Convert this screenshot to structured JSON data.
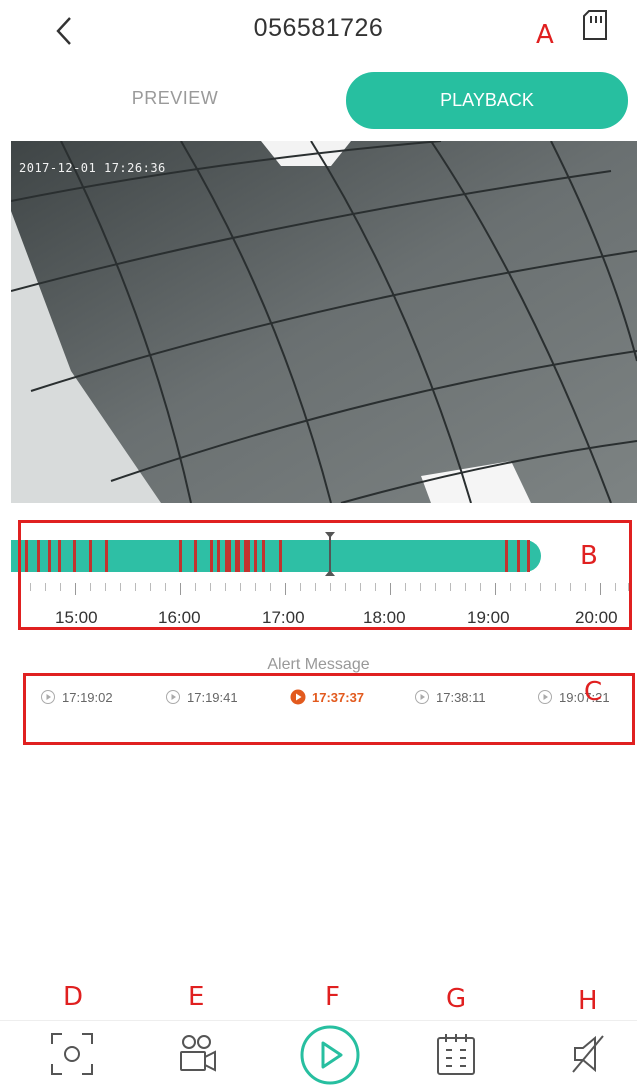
{
  "header": {
    "title": "056581726",
    "back_icon": "chevron-left-icon",
    "sd_card_icon": "sd-card-icon"
  },
  "tabs": [
    {
      "label": "PREVIEW",
      "active": false
    },
    {
      "label": "PLAYBACK",
      "active": true
    }
  ],
  "colors": {
    "accent": "#27bfa0",
    "event": "#c2332f",
    "alert_active": "#e25a1e",
    "annotation": "#e02020"
  },
  "video": {
    "timestamp": "2017-12-01 17:26:36"
  },
  "timeline": {
    "labels": [
      "15:00",
      "16:00",
      "17:00",
      "18:00",
      "19:00",
      "20:00"
    ]
  },
  "alerts": {
    "title": "Alert Message",
    "items": [
      {
        "time": "17:19:02",
        "active": false
      },
      {
        "time": "17:19:41",
        "active": false
      },
      {
        "time": "17:37:37",
        "active": true
      },
      {
        "time": "17:38:11",
        "active": false
      },
      {
        "time": "19:07:21",
        "active": false
      }
    ]
  },
  "annotations": {
    "A": "A",
    "B": "B",
    "C": "C",
    "D": "D",
    "E": "E",
    "F": "F",
    "G": "G",
    "H": "H"
  },
  "toolbar": {
    "icons": [
      "screenshot-icon",
      "record-icon",
      "play-icon",
      "calendar-icon",
      "mute-icon"
    ]
  }
}
